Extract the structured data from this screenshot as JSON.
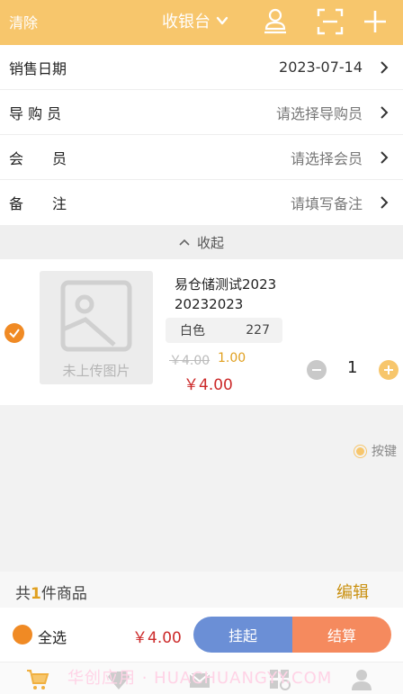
{
  "header": {
    "clear_label": "清除",
    "title": "收银台",
    "icons": [
      "user-icon",
      "scan-icon",
      "plus-icon"
    ],
    "bg_color": "#f7c66c"
  },
  "form": {
    "sale_date": {
      "label": "销售日期",
      "value": "2023-07-14"
    },
    "guide": {
      "label": "导 购 员",
      "placeholder": "请选择导购员"
    },
    "member": {
      "label": "会　　员",
      "placeholder": "请选择会员"
    },
    "remark": {
      "label": "备　　注",
      "placeholder": "请填写备注"
    }
  },
  "collapse_label": "收起",
  "product": {
    "name": "易仓储测试2023",
    "code": "20232023",
    "spec_color": "白色",
    "spec_stock": "227",
    "image_placeholder": "未上传图片",
    "original_price": "￥4.00",
    "discount": "1.00",
    "price": "￥4.00",
    "quantity": "1"
  },
  "radio_key_label": "按键",
  "summary": {
    "count_prefix": "共",
    "count_number": "1",
    "count_suffix": "件商品",
    "edit_label": "编辑"
  },
  "actions": {
    "select_all_label": "全选",
    "total": "￥4.00",
    "hang_label": "挂起",
    "checkout_label": "结算",
    "hang_color": "#6b8fd6",
    "checkout_color": "#f58a5e"
  },
  "tabbar": {
    "watermark": "华创应用 · HUACHUANGYY.COM",
    "icons": [
      "cart-icon",
      "diamond-icon",
      "mail-icon",
      "grid-search-icon",
      "user-icon"
    ]
  }
}
